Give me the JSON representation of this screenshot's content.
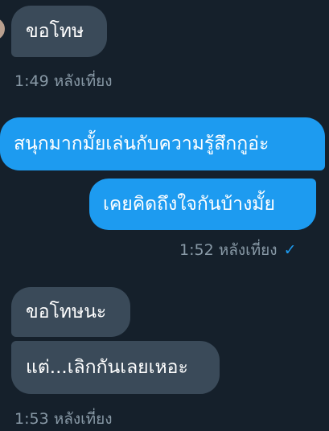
{
  "conversation": {
    "messages": [
      {
        "text": "ขอโทษ",
        "direction": "incoming"
      },
      {
        "text": "สนุกมากมั้ยเล่นกับความรู้สึกกูอ่ะ",
        "direction": "outgoing"
      },
      {
        "text": "เคยคิดถึงใจกันบ้างมั้ย",
        "direction": "outgoing"
      },
      {
        "text": "ขอโทษนะ",
        "direction": "incoming"
      },
      {
        "text": "แต่...เลิกกันเลยเหอะ",
        "direction": "incoming"
      }
    ],
    "timestamps": [
      {
        "text": "1:49 หลังเที่ยง"
      },
      {
        "text": "1:52 หลังเที่ยง",
        "read_mark": "✓"
      },
      {
        "text": "1:53 หลังเที่ยง"
      }
    ]
  },
  "colors": {
    "background": "#15202b",
    "incoming_bubble": "#3a4a59",
    "outgoing_bubble": "#1d9bf0",
    "timestamp": "#8899a6"
  },
  "icons": {
    "read_receipt": "check-icon"
  }
}
